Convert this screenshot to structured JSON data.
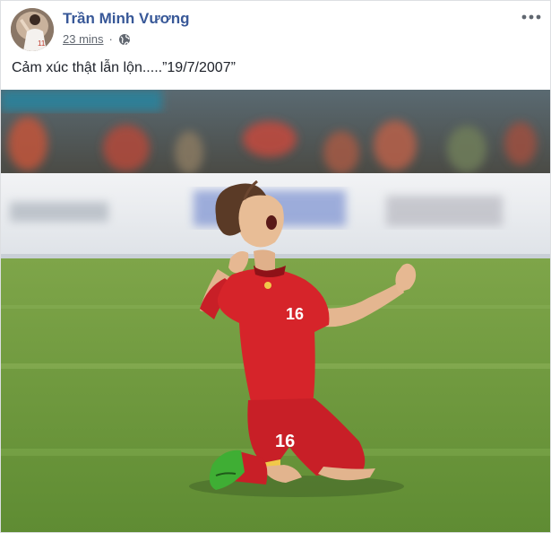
{
  "post": {
    "author": "Trần Minh Vương",
    "timestamp": "23 mins",
    "separator": "·",
    "privacy_icon": "globe-icon",
    "more_icon": "ellipsis-icon",
    "text": "Cảm xúc thật lẫn lộn.....”19/7/2007”",
    "photo": {
      "jersey_number": "16",
      "description_icon": "photo"
    }
  },
  "colors": {
    "author_link": "#385898",
    "meta_text": "#616770",
    "body_text": "#1d2129",
    "jersey_red": "#d6242a",
    "pitch_green": "#6f9a3f"
  }
}
